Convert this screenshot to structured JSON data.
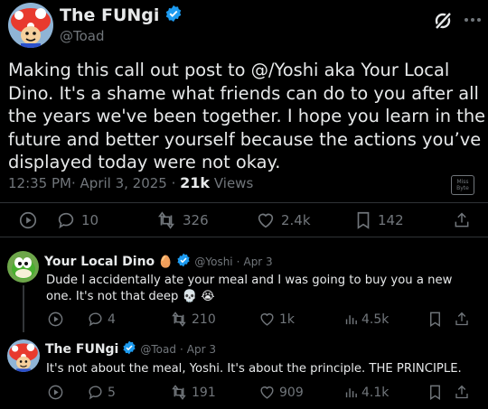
{
  "post": {
    "author_name": "The FUNgi",
    "handle": "@Toad",
    "text": "Making this call out post to @/Yoshi aka Your Local Dino. It's a shame what friends can do to you after all the years we've been together. I hope you learn in the future and better yourself because the actions you’ve displayed today were not okay.",
    "time": "12:35 PM",
    "date": "April 3, 2025",
    "views_count": "21k",
    "views_label": "Views",
    "stamp_text": "Miss Byte",
    "stats": {
      "replies": "10",
      "reposts": "326",
      "likes": "2.4k",
      "bookmarks": "142"
    }
  },
  "replies": [
    {
      "author_name": "Your Local Dino",
      "emoji": "🥚",
      "handle": "@Yoshi",
      "date": "Apr 3",
      "text": "Dude I accidentally ate your meal and I was going to buy you a new one. It's not that deep 💀 😭",
      "stats": {
        "replies": "4",
        "reposts": "210",
        "likes": "1k",
        "views": "4.5k"
      }
    },
    {
      "author_name": "The FUNgi",
      "emoji": "",
      "handle": "@Toad",
      "date": "Apr 3",
      "text": "It's not about the meal, Yoshi. It's about the principle. THE PRINCIPLE.",
      "stats": {
        "replies": "5",
        "reposts": "191",
        "likes": "909",
        "views": "4.1k"
      }
    }
  ],
  "colors": {
    "verified": "#1d9bf0",
    "divider": "#2f3336",
    "muted": "#71767b",
    "text": "#e7e9ea"
  }
}
